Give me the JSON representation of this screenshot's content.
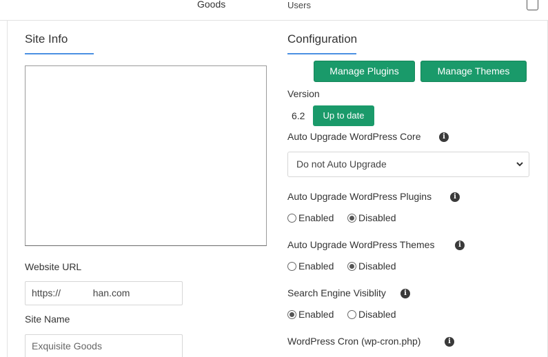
{
  "top": {
    "goods_text": "Goods",
    "users_text": "Users"
  },
  "site_info": {
    "title": "Site Info",
    "description_value": "",
    "website_url_label": "Website URL",
    "website_url_value": "https://            han.com",
    "site_name_label": "Site Name",
    "site_name_placeholder": "Exquisite Goods"
  },
  "configuration": {
    "title": "Configuration",
    "manage_plugins_label": "Manage Plugins",
    "manage_themes_label": "Manage Themes",
    "version_label": "Version",
    "version_value": "6.2",
    "version_status": "Up to date",
    "auto_upgrade_core_label": "Auto Upgrade WordPress Core",
    "auto_upgrade_core_selected": "Do not Auto Upgrade",
    "auto_upgrade_plugins_label": "Auto Upgrade WordPress Plugins",
    "auto_upgrade_plugins_enabled_label": "Enabled",
    "auto_upgrade_plugins_disabled_label": "Disabled",
    "auto_upgrade_plugins_value": "Disabled",
    "auto_upgrade_themes_label": "Auto Upgrade WordPress Themes",
    "auto_upgrade_themes_enabled_label": "Enabled",
    "auto_upgrade_themes_disabled_label": "Disabled",
    "auto_upgrade_themes_value": "Disabled",
    "search_engine_label": "Search Engine Visiblity",
    "search_engine_enabled_label": "Enabled",
    "search_engine_disabled_label": "Disabled",
    "search_engine_value": "Enabled",
    "wp_cron_label": "WordPress Cron (wp-cron.php)",
    "info_icon_glyph": "i"
  },
  "colors": {
    "accent_green": "#1a9a6a",
    "title_underline_blue": "#4a90e2"
  }
}
